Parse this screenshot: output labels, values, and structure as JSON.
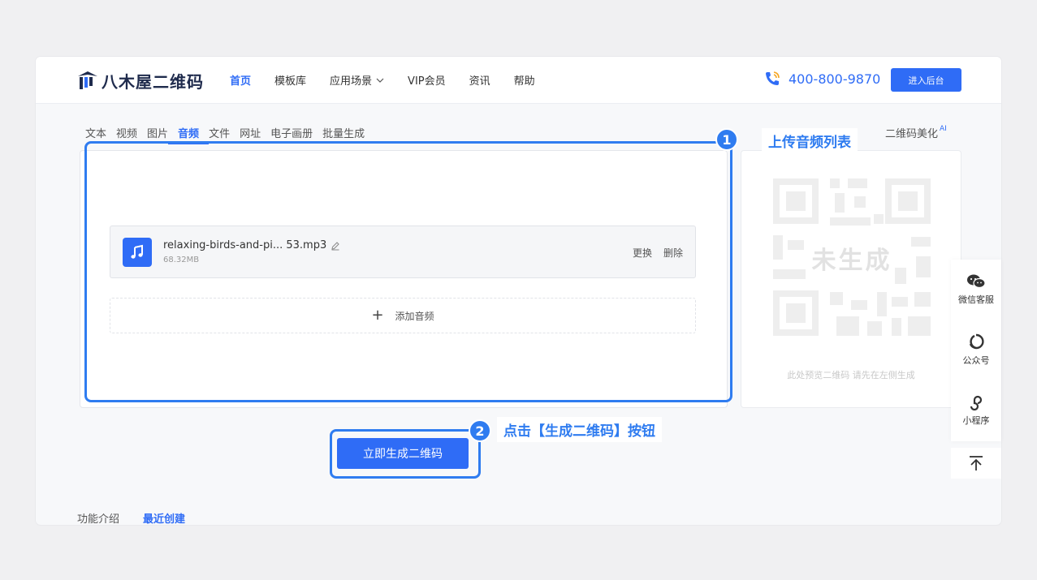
{
  "brand": {
    "name": "八木屋二维码"
  },
  "nav": {
    "items": [
      {
        "label": "首页",
        "active": true
      },
      {
        "label": "模板库",
        "active": false
      },
      {
        "label": "应用场景",
        "active": false,
        "dropdown": true
      },
      {
        "label": "VIP会员",
        "active": false
      },
      {
        "label": "资讯",
        "active": false
      },
      {
        "label": "帮助",
        "active": false
      }
    ]
  },
  "header": {
    "phone": "400-800-9870",
    "admin_button": "进入后台"
  },
  "tabs": [
    "文本",
    "视频",
    "图片",
    "音频",
    "文件",
    "网址",
    "电子画册",
    "批量生成"
  ],
  "active_tab": "音频",
  "beautify": {
    "label": "二维码美化",
    "badge": "AI"
  },
  "upload": {
    "file_name": "relaxing-birds-and-pi... 53.mp3",
    "file_size": "68.32MB",
    "replace_label": "更换",
    "delete_label": "删除",
    "add_label": "添加音频"
  },
  "preview": {
    "placeholder": "未生成",
    "hint": "此处预览二维码 请先在左侧生成"
  },
  "generate_button": "立即生成二维码",
  "bottom_tabs": [
    {
      "label": "功能介绍",
      "active": false
    },
    {
      "label": "最近创建",
      "active": true
    }
  ],
  "annotations": [
    {
      "number": "1",
      "text": "上传音频列表"
    },
    {
      "number": "2",
      "text": "点击【生成二维码】按钮"
    }
  ],
  "side_bar": {
    "items": [
      {
        "label": "微信客服",
        "icon": "wechat-icon"
      },
      {
        "label": "公众号",
        "icon": "official-account-icon"
      },
      {
        "label": "小程序",
        "icon": "mini-program-icon"
      }
    ],
    "back_to_top_icon": "arrow-up-icon"
  },
  "colors": {
    "accent": "#2f6cf6",
    "annotation": "#2f7cf0"
  }
}
